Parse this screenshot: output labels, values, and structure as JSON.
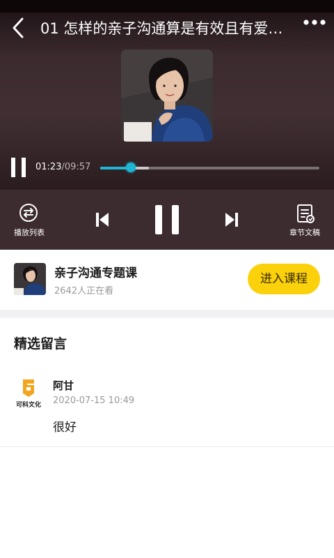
{
  "player": {
    "title": "01 怎样的亲子沟通算是有效且有爱…",
    "current_time": "01:23",
    "separator": "/",
    "total_time": "09:57",
    "progress": 0.139,
    "buffered": 0.223,
    "accent_color": "#1fb5d4"
  },
  "controls": {
    "playlist_label": "播放列表",
    "transcript_label": "章节文稿"
  },
  "course": {
    "name": "亲子沟通专题课",
    "viewers": "2642人正在看",
    "enter_label": "进入课程",
    "button_color": "#fbd10b"
  },
  "comments": {
    "section_title": "精选留言",
    "items": [
      {
        "author": "阿甘",
        "time": "2020-07-15 10:49",
        "text": "很好",
        "avatar_caption": "可科文化"
      }
    ]
  }
}
